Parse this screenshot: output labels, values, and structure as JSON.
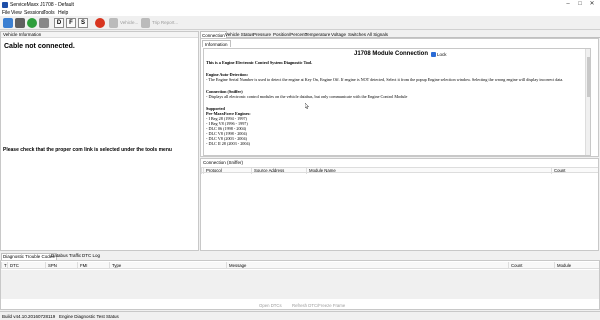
{
  "window": {
    "title": "ServiceMaxx J1708 - Default"
  },
  "menu": [
    "File",
    "View",
    "Sessions",
    "Tools",
    "Help"
  ],
  "toolbar": {
    "d_label": "D",
    "f_label": "F",
    "s_label": "S",
    "vehicle_label": "Vehicle...",
    "trip_report_label": "Trip Report..."
  },
  "left_panel": {
    "header": "Vehicle Information",
    "status": "Cable not connected.",
    "hint": "Please check that the proper com link is selected under the tools menu"
  },
  "tabs": [
    "Connection",
    "Vehicle Status",
    "Pressure",
    "Position/Percent",
    "Temperature",
    "Voltage",
    "Switches",
    "All Signals"
  ],
  "info": {
    "subtab": "Information",
    "heading": "J1708 Module Connection",
    "lock": "Lock",
    "intro": "This is a Engine Electronic Control System Diagnostic Tool.",
    "auto_title": "Engine Auto-Detection:",
    "auto_text": "- The Engine Serial Number is used to detect the engine at Key On, Engine Off. If engine is NOT detected, Select it from the popup Engine selection window. Selecting the wrong engine will display incorrect data.",
    "sniffer_title": "Connection (Sniffer)",
    "sniffer_text": "- Displays all electronic control modules on the vehicle databus, but only communicate with the Engine Control Module",
    "supported_title": "Supported",
    "premaxx_title": "Pre-MaxxForce Engines:",
    "engines": [
      "- I Beg 28 (1994 - 1997)",
      "- I Beg V8 (1996 - 1997)",
      "- DLC 06 (1998 - 2004)",
      "- DLC V8 (1998 - 2004)",
      "- DLC V8 (2003 - 2004)",
      "- DLC II 28 (2003 - 2004)"
    ]
  },
  "sniffer": {
    "header": "Connection (Sniffer)",
    "columns": [
      "Protocol",
      "Source Address",
      "Module Name",
      "Count"
    ]
  },
  "bottom_tabs": [
    "Diagnostic Trouble Codes",
    "Databus Traffic",
    "DTC Log"
  ],
  "dtc": {
    "columns": [
      "T",
      "DTC",
      "SPN",
      "FMI",
      "Type",
      "Message",
      "Count",
      "Module"
    ],
    "actions": {
      "open": "Open DTCs",
      "refresh": "Refresh DTC/Freeze Frame"
    }
  },
  "statusbar": {
    "build": "Build v44.10.20160728119",
    "status": "Engine Diagnostic Test Status"
  },
  "colors": {
    "accent": "#1f4fa8",
    "tool_green": "#2e9e3c",
    "tool_red": "#d8351f",
    "tool_gray": "#8a8a8a"
  }
}
